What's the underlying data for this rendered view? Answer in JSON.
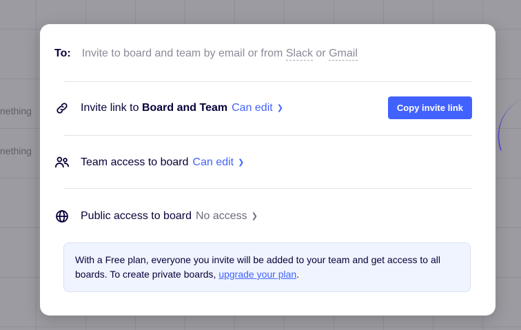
{
  "background": {
    "text_fragments": [
      "nething",
      "nething"
    ]
  },
  "invite": {
    "to_label": "To:",
    "placeholder_prefix": "Invite to board and team by email or from",
    "placeholder_slack": "Slack",
    "placeholder_or": "or",
    "placeholder_gmail": "Gmail"
  },
  "link_row": {
    "prefix": "Invite link to",
    "target": "Board and Team",
    "permission": "Can edit",
    "button_label": "Copy invite link"
  },
  "team_row": {
    "label": "Team access to board",
    "permission": "Can edit"
  },
  "public_row": {
    "label": "Public access to board",
    "permission": "No access"
  },
  "notice": {
    "text": "With a Free plan, everyone you invite will be added to your team and get access to all boards. To create private boards,",
    "link": "upgrade your plan",
    "suffix": "."
  },
  "icons": {
    "link": "link-icon",
    "team": "people-icon",
    "public": "globe-icon",
    "dropdown": "chevron-down-icon"
  },
  "colors": {
    "accent": "#4262ff",
    "text": "#050038",
    "muted": "#8a8a99",
    "notice_bg": "#f0f4ff"
  }
}
